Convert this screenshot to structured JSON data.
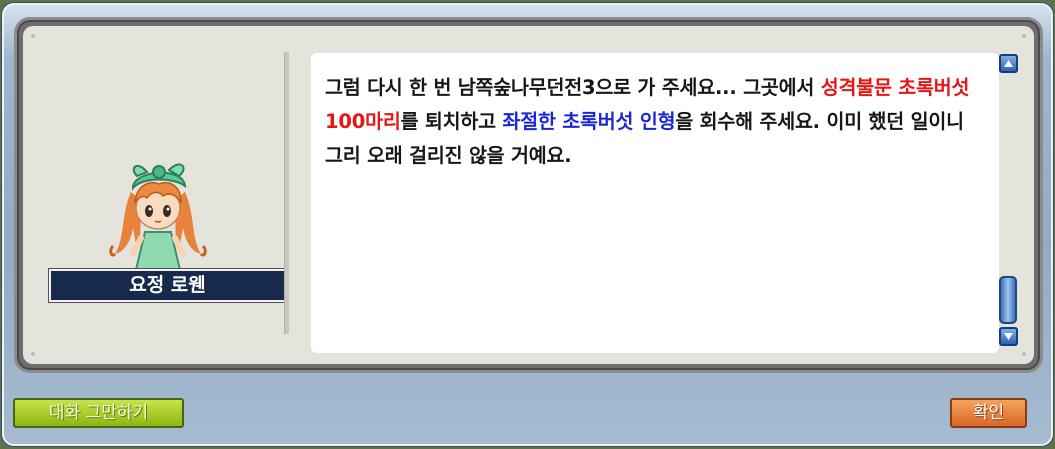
{
  "npc": {
    "name": "요정 로웬"
  },
  "dialog": {
    "text_1": "그럼 다시 한 번 남쪽숲나무던전3으로 가 주세요... 그곳에서 ",
    "highlight_monster": "성격불문 초록버섯 100마리",
    "text_2": "를 퇴치하고 ",
    "highlight_item": "좌절한 초록버섯 인형",
    "text_3": "을 회수해 주세요. 이미 했던 일이니 그리 오래 걸리진 않을 거예요."
  },
  "buttons": {
    "end_chat": "대화 그만하기",
    "confirm": "확인"
  },
  "colors": {
    "highlight_red": "#e41616",
    "highlight_blue": "#1b27d6",
    "name_plate": "#172a4b",
    "end_button": "#a6c92a",
    "confirm_button": "#e8823f"
  },
  "icons": {
    "scroll_up": "scroll-up-arrow",
    "scroll_down": "scroll-down-arrow"
  }
}
